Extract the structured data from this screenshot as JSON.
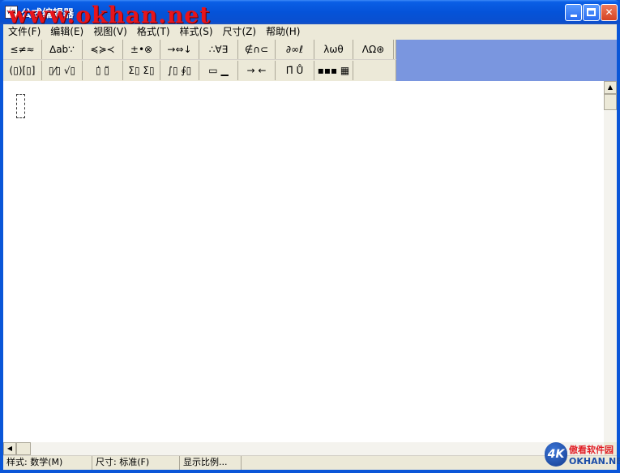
{
  "window": {
    "title": "公式编辑器",
    "icon_glyph": "√α",
    "watermark": "www.okhan.net"
  },
  "menubar": {
    "items": [
      {
        "label": "文件(F)"
      },
      {
        "label": "编辑(E)"
      },
      {
        "label": "视图(V)"
      },
      {
        "label": "格式(T)"
      },
      {
        "label": "样式(S)"
      },
      {
        "label": "尺寸(Z)"
      },
      {
        "label": "帮助(H)"
      }
    ]
  },
  "palette": {
    "row1": [
      {
        "glyph": "≤≠≈"
      },
      {
        "glyph": "∆ab∵"
      },
      {
        "glyph": "≼≽≺"
      },
      {
        "glyph": "±•⊗"
      },
      {
        "glyph": "→⇔↓"
      },
      {
        "glyph": "∴∀∃"
      },
      {
        "glyph": "∉∩⊂"
      },
      {
        "glyph": "∂∞ℓ"
      },
      {
        "glyph": "λωθ"
      },
      {
        "glyph": "ΛΩ⊛"
      }
    ],
    "row2": [
      {
        "glyph": "(▯)[▯]"
      },
      {
        "glyph": "▯⁄▯ √▯"
      },
      {
        "glyph": "▯̇ ▯̈"
      },
      {
        "glyph": "Σ▯ Σ▯"
      },
      {
        "glyph": "∫▯ ∮▯"
      },
      {
        "glyph": "▭ ▁"
      },
      {
        "glyph": "→ ←"
      },
      {
        "glyph": "Π̄ Ů"
      },
      {
        "glyph": "▪▪▪ ▦"
      }
    ]
  },
  "statusbar": {
    "style": "样式: 数学(M)",
    "size": "尺寸: 标准(F)",
    "zoom": "显示比例..."
  },
  "logo": {
    "badge": "4K",
    "cn": "傲看软件园",
    "en": "OKHAN.NET"
  },
  "colors": {
    "titlebar": "#0553d8",
    "toolbar_bg": "#7a96df",
    "chrome": "#ece9d8",
    "watermark": "#e8141b"
  }
}
